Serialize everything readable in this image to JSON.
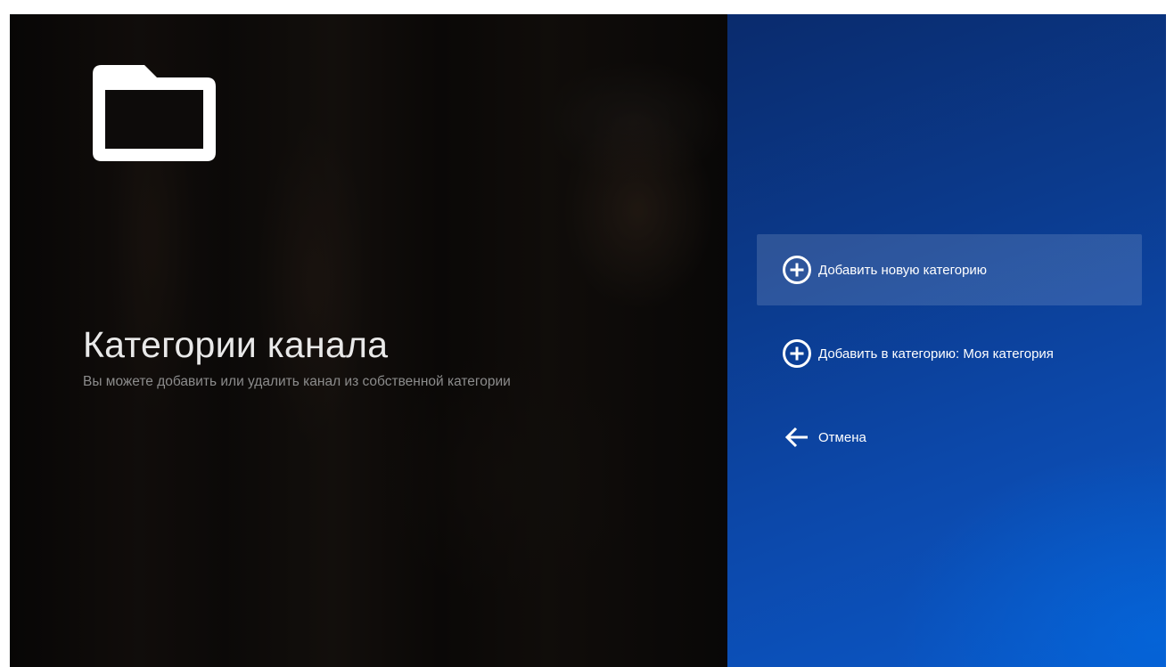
{
  "screen": {
    "title": "Категории канала",
    "subtitle": "Вы можете добавить или удалить канал из собственной категории",
    "header_icon": "folder-icon"
  },
  "menu": {
    "items": [
      {
        "label": "Добавить новую категорию",
        "icon": "add-circle-icon",
        "focused": true
      },
      {
        "label": "Добавить в категорию: Моя категория",
        "icon": "add-circle-icon",
        "focused": false
      },
      {
        "label": "Отмена",
        "icon": "arrow-back-icon",
        "focused": false
      }
    ]
  },
  "colors": {
    "panel_blue": "#0c48aa",
    "text_primary": "#ffffff",
    "text_secondary": "#8c8c8c"
  }
}
